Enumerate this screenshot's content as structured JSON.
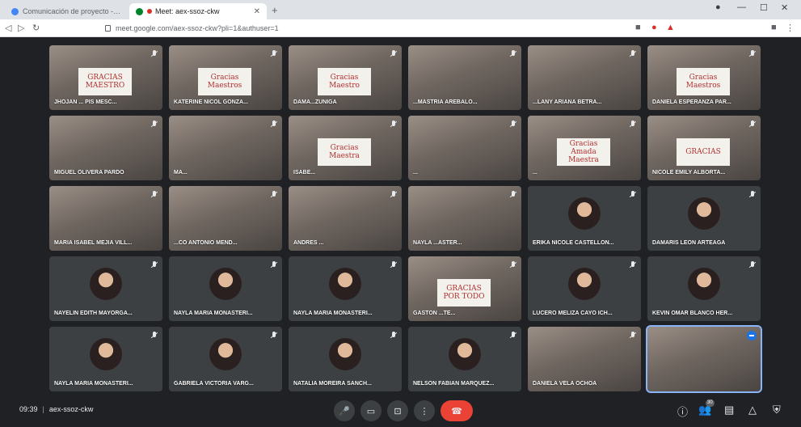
{
  "browser": {
    "tabs": [
      {
        "label": "Comunicación de proyecto - Colaborat",
        "active": false
      },
      {
        "label": "Meet: aex-ssoz-ckw",
        "active": true
      }
    ],
    "new_tab": "+",
    "url": "meet.google.com/aex-ssoz-ckw?pli=1&authuser=1",
    "window_controls": [
      "●",
      "—",
      "☐",
      "✕"
    ]
  },
  "meeting": {
    "time": "09:39",
    "separator": "|",
    "code": "aex-ssoz-ckw"
  },
  "participants": [
    {
      "name": "JHOJAN ... PIS MESC...",
      "sign": "GRACIAS\nMAESTRO"
    },
    {
      "name": "KATERINE NICOL GONZA...",
      "sign": "Gracias Maestros"
    },
    {
      "name": "DAMA...ZÚÑIGA",
      "sign": "Gracias Maestro"
    },
    {
      "name": "...MASTRIA AREBALO...",
      "sign": ""
    },
    {
      "name": "...LANY ARIANA BETRA...",
      "sign": ""
    },
    {
      "name": "DANIELA ESPERANZA PAR...",
      "sign": "Gracias Maestros"
    },
    {
      "name": "MIGUEL OLIVERA PARDO",
      "sign": ""
    },
    {
      "name": "MA...",
      "sign": ""
    },
    {
      "name": "ISABE...",
      "sign": "Gracias Maestra"
    },
    {
      "name": "...",
      "sign": ""
    },
    {
      "name": "...",
      "sign": "Gracias Amada Maestra"
    },
    {
      "name": "NICOLE EMILY ALBORTA...",
      "sign": "GRACIAS"
    },
    {
      "name": "MARÍA ISABEL MEJÍA VILL...",
      "sign": ""
    },
    {
      "name": "...CO ANTONIO MEND...",
      "sign": ""
    },
    {
      "name": "ANDRES ...",
      "sign": ""
    },
    {
      "name": "NAYLA ...ASTER...",
      "sign": ""
    },
    {
      "name": "ERIKA NICOLE CASTELLON...",
      "sign": ""
    },
    {
      "name": "DAMARIS LEON ARTEAGA",
      "sign": ""
    },
    {
      "name": "NAYELIN EDITH MAYORGA...",
      "sign": ""
    },
    {
      "name": "NAYLA MARÍA MONASTERI...",
      "sign": ""
    },
    {
      "name": "NAYLA MARÍA MONASTERI...",
      "sign": ""
    },
    {
      "name": "GASTON ...TE...",
      "sign": "GRACIAS POR TODO"
    },
    {
      "name": "LUCERO MELIZA CAYO ICH...",
      "sign": ""
    },
    {
      "name": "KEVIN OMAR BLANCO HER...",
      "sign": ""
    },
    {
      "name": "NAYLA MARÍA MONASTERI...",
      "sign": ""
    },
    {
      "name": "GABRIELA VICTORIA VARG...",
      "sign": ""
    },
    {
      "name": "NATALIA MOREIRA SANCH...",
      "sign": ""
    },
    {
      "name": "NELSON FABIAN MARQUEZ...",
      "sign": ""
    },
    {
      "name": "DANIELA VELA OCHOA",
      "sign": ""
    },
    {
      "name": "",
      "sign": ""
    }
  ],
  "controls": {
    "mic": "🎤",
    "camera": "▭",
    "present": "⊡",
    "more": "⋮",
    "hangup": "☎"
  },
  "right_controls": {
    "info": "ⓘ",
    "people": "👥",
    "people_count": "30",
    "chat": "▤",
    "activities": "△",
    "safety": "⛨"
  }
}
